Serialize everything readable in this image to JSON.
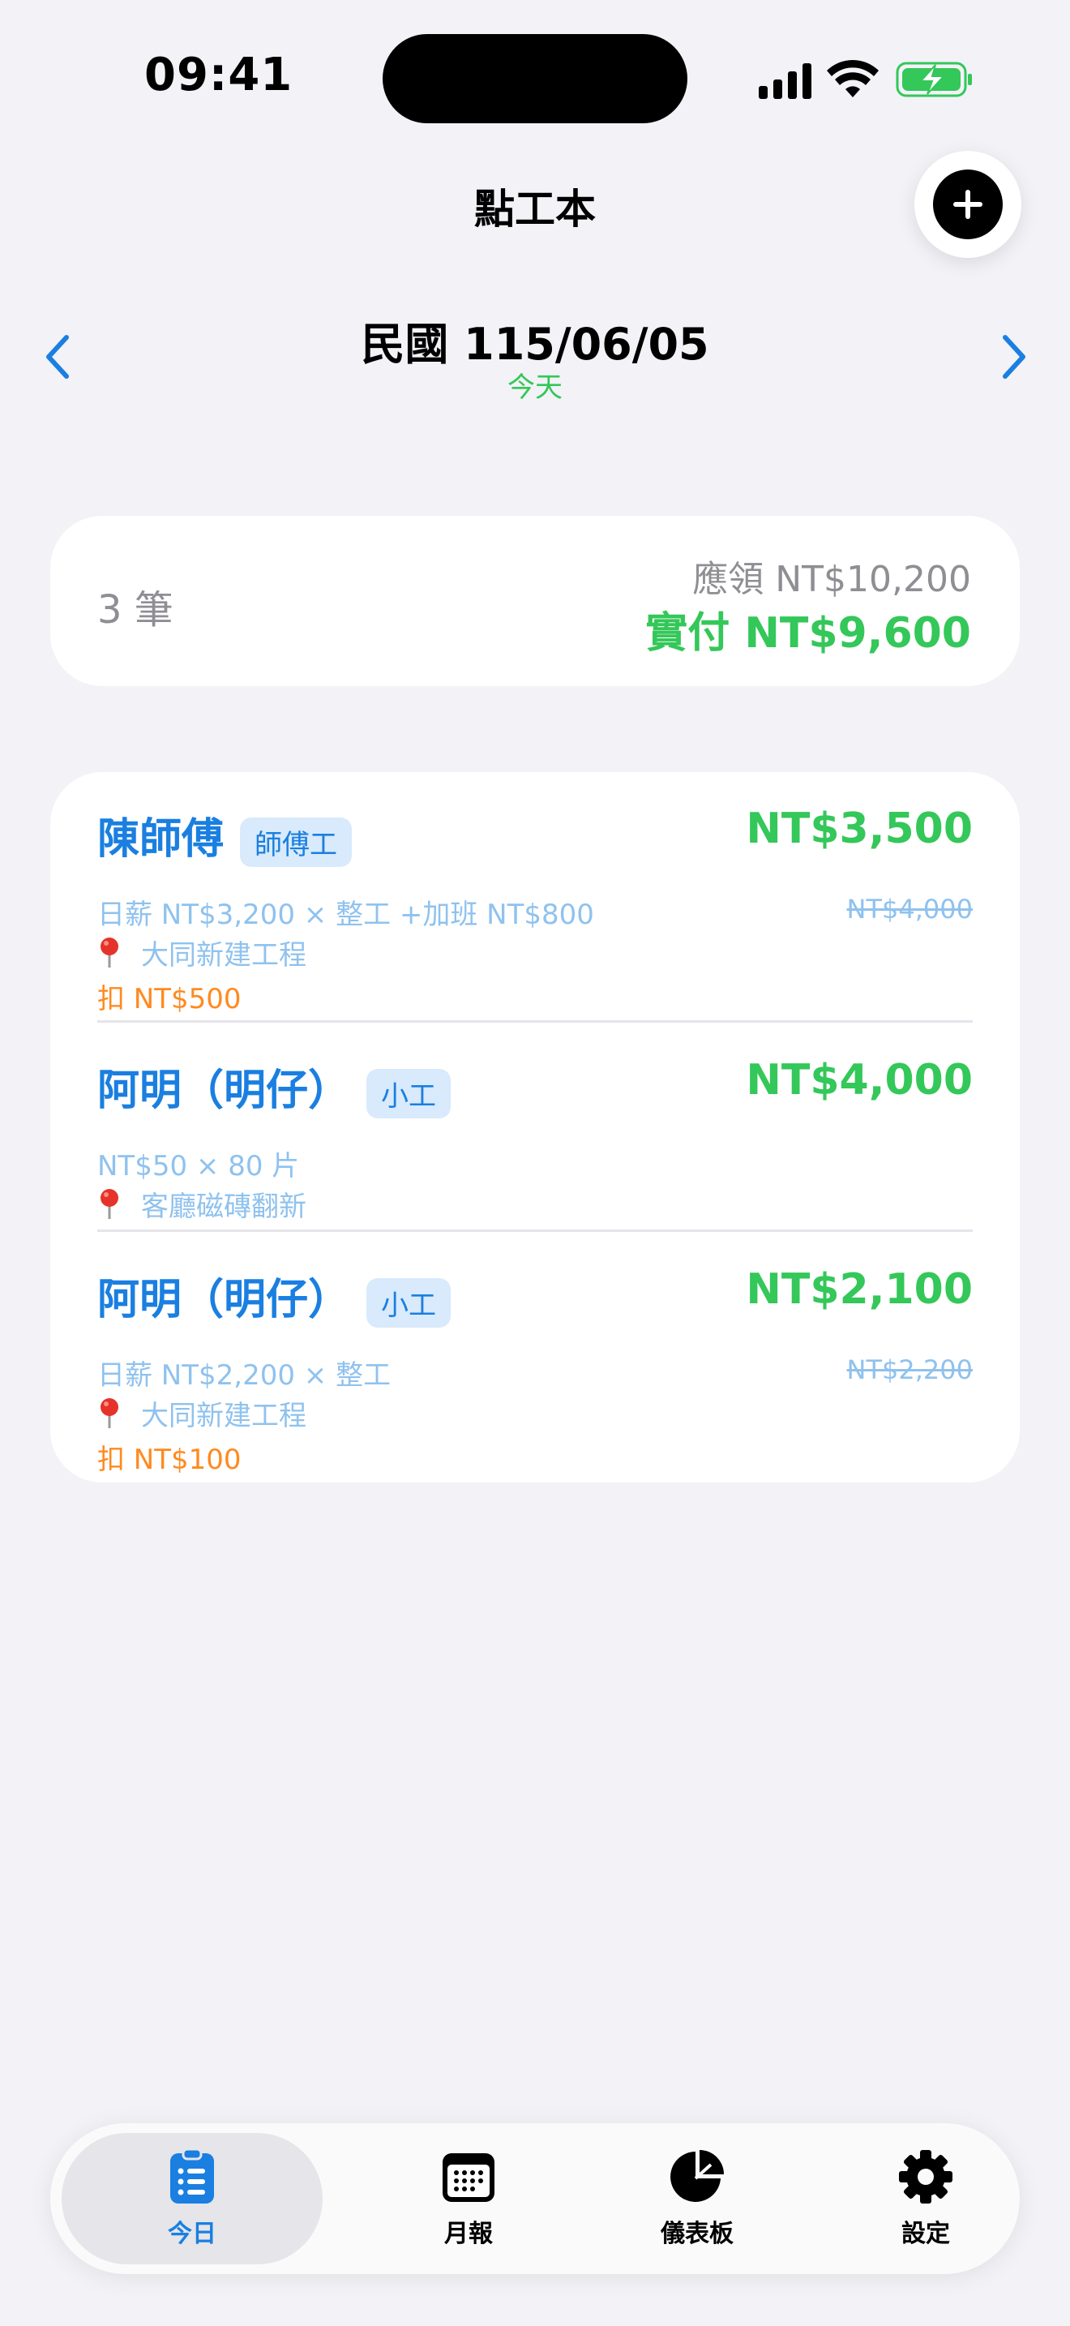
{
  "status_bar": {
    "time": "09:41"
  },
  "header": {
    "title": "點工本"
  },
  "date_nav": {
    "date": "民國 115/06/05",
    "subtitle": "今天"
  },
  "summary": {
    "count": "3 筆",
    "gross": "應領 NT$10,200",
    "net": "實付 NT$9,600"
  },
  "entries": [
    {
      "name": "陳師傅",
      "role": "師傅工",
      "detail": "日薪 NT$3,200 × 整工 +加班 NT$800",
      "location": "大同新建工程",
      "deduction": "扣 NT$500",
      "amount": "NT$3,500",
      "original_amount": "NT$4,000"
    },
    {
      "name": "阿明（明仔）",
      "role": "小工",
      "detail": "NT$50 × 80 片",
      "location": "客廳磁磚翻新",
      "amount": "NT$4,000"
    },
    {
      "name": "阿明（明仔）",
      "role": "小工",
      "detail": "日薪 NT$2,200 × 整工",
      "location": "大同新建工程",
      "deduction": "扣 NT$100",
      "amount": "NT$2,100",
      "original_amount": "NT$2,200"
    }
  ],
  "tabs": [
    {
      "label": "今日",
      "icon": "clipboard-list-icon",
      "active": true
    },
    {
      "label": "月報",
      "icon": "calendar-icon",
      "active": false
    },
    {
      "label": "儀表板",
      "icon": "pie-chart-icon",
      "active": false
    },
    {
      "label": "設定",
      "icon": "gear-icon",
      "active": false
    }
  ],
  "colors": {
    "accent": "#1a7fe0",
    "positive": "#34c759",
    "deduction": "#ff8a1f",
    "muted": "#8e8e93"
  }
}
